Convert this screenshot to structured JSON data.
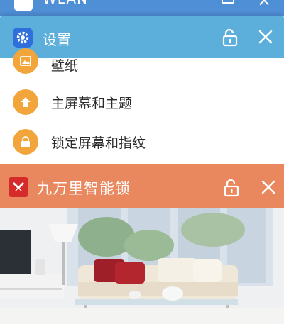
{
  "top_card": {
    "title": "WLAN"
  },
  "settings_card": {
    "title": "设置",
    "items": [
      {
        "label": "壁纸",
        "icon": "wallpaper-icon"
      },
      {
        "label": "主屏幕和主题",
        "icon": "home-theme-icon"
      },
      {
        "label": "锁定屏幕和指纹",
        "icon": "lock-screen-fingerprint-icon"
      }
    ]
  },
  "lock_card": {
    "title": "九万里智能锁",
    "content": "living-room-photo"
  },
  "colors": {
    "settings_header": "#5caedb",
    "lock_header": "#e9875e",
    "item_icon_bg": "#f2a53b"
  }
}
